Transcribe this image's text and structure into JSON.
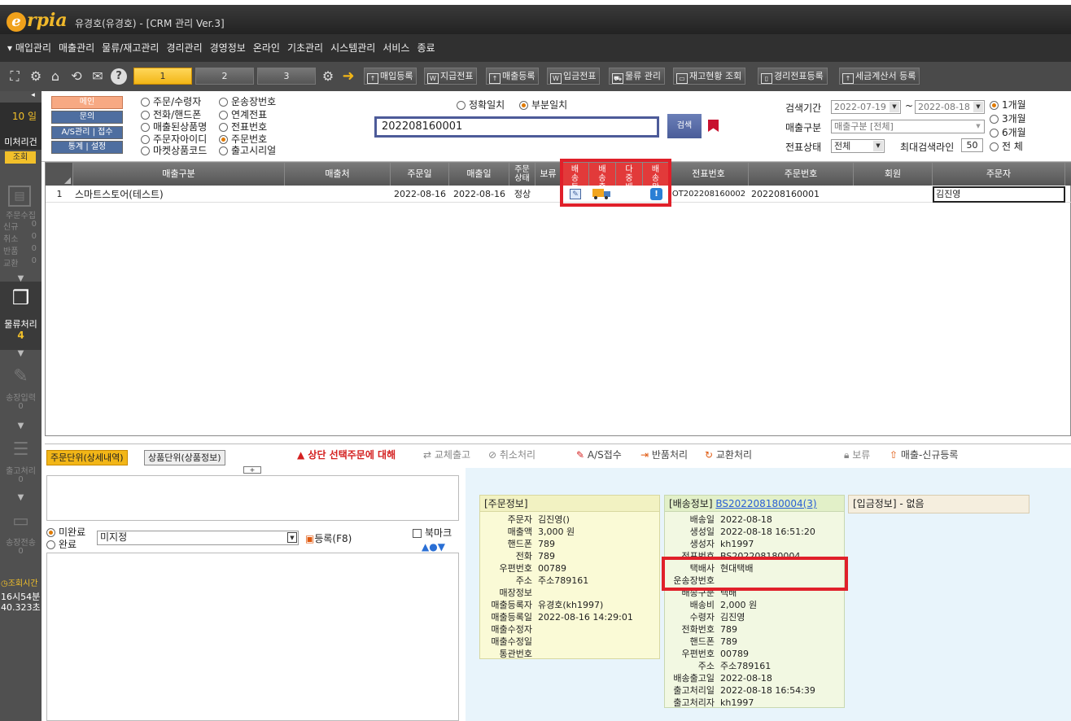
{
  "app": {
    "logo_letter": "e",
    "logo_text": "rpia",
    "title": "유경호(유경호) - [CRM 관리 Ver.3]"
  },
  "menu": [
    "▾ 매입관리",
    "매출관리",
    "물류/재고관리",
    "경리관리",
    "경영정보",
    "온라인",
    "기초관리",
    "시스템관리",
    "서비스",
    "종료"
  ],
  "toolbar": {
    "pages": [
      "1",
      "2",
      "3"
    ],
    "buttons": [
      "매입등록",
      "지급전표",
      "매출등록",
      "입금전표",
      "물류 관리",
      "재고현황 조회",
      "경리전표등록",
      "세금계산서 등록"
    ]
  },
  "sidebar": {
    "date": "10 일",
    "unprocessed": "미처리건",
    "lookup": "조회",
    "order": "주문수집",
    "new": "신규",
    "new_n": "0",
    "cancel": "취소",
    "cancel_n": "0",
    "ret": "반품",
    "ret_n": "0",
    "exch": "교환",
    "exch_n": "0",
    "logistics": "물류처리",
    "logistics_n": "4",
    "invoice": "송장입력",
    "invoice_n": "0",
    "release": "출고처리",
    "release_n": "0",
    "send": "송장전송",
    "send_n": "0",
    "time_label": "조회시간",
    "time1": "16시54분",
    "time2": "40.323초"
  },
  "filter": {
    "pills": [
      "메인",
      "문의",
      "A/S관리 | 접수",
      "통계 | 설정"
    ],
    "col1": [
      "주문/수령자",
      "전화/핸드폰",
      "매출된상품명",
      "주문자아이디",
      "마켓상품코드"
    ],
    "col2": [
      "운송장번호",
      "연계전표",
      "전표번호",
      "주문번호",
      "출고시리얼"
    ],
    "match_exact": "정확일치",
    "match_partial": "부분일치",
    "search_value": "202208160001",
    "search_btn": "검색",
    "period_label": "검색기간",
    "date_from": "2022-07-19",
    "date_to": "2022-08-18",
    "tilde": "~",
    "sales_label": "매출구분",
    "sales_value": "매출구분 [전체]",
    "status_label": "전표상태",
    "status_value": "전체",
    "max_label": "최대검색라인",
    "max_value": "50",
    "ranges": [
      "1개월",
      "3개월",
      "6개월",
      "전 체"
    ]
  },
  "grid": {
    "headers": [
      "매출구분",
      "매출처",
      "주문일",
      "매출일",
      "주문상태",
      "보류",
      "배송등록",
      "배송출고",
      "다중배송",
      "배송완료",
      "전표번호",
      "주문번호",
      "회원",
      "주문자"
    ],
    "row": {
      "no": "1",
      "sales_type": "스마트스토어(테스트)",
      "order_date": "2022-08-16",
      "sales_date": "2022-08-16",
      "status": "정상",
      "slip": "OT202208160002",
      "order_no": "202208160001",
      "buyer": "김진영"
    }
  },
  "bottom": {
    "tab1": "주문단위(상세내역)",
    "tab2": "상품단위(상품정보)",
    "notice": "▲ 상단 선택주문에 대해",
    "actions": [
      "교체출고",
      "취소처리",
      "A/S접수",
      "반품처리",
      "교환처리",
      "보류",
      "매출-신규등록"
    ],
    "incomplete": "미완료",
    "complete": "완료",
    "memo_select": "미지정",
    "register": "등록(F8)",
    "bookmark": "북마크",
    "plus": "+"
  },
  "order_info": {
    "title": "[주문정보]",
    "rows": [
      [
        "주문자",
        "김진영()"
      ],
      [
        "매출액",
        "3,000 원"
      ],
      [
        "핸드폰",
        "789"
      ],
      [
        "전화",
        "789"
      ],
      [
        "우편번호",
        "00789"
      ],
      [
        "주소",
        "주소789161"
      ],
      [
        "매장정보",
        ""
      ],
      [
        "매출등록자",
        "유경호(kh1997)"
      ],
      [
        "매출등록일",
        "2022-08-16 14:29:01"
      ],
      [
        "매출수정자",
        ""
      ],
      [
        "매출수정일",
        ""
      ],
      [
        "통관번호",
        ""
      ]
    ]
  },
  "ship_info": {
    "title": "[배송정보]",
    "link": "BS202208180004(3)",
    "rows": [
      [
        "배송일",
        "2022-08-18"
      ],
      [
        "생성일",
        "2022-08-18 16:51:20"
      ],
      [
        "생성자",
        "kh1997"
      ],
      [
        "전표번호",
        "BS202208180004"
      ],
      [
        "택배사",
        "현대택배"
      ],
      [
        "운송장번호",
        ""
      ],
      [
        "배송구분",
        "택배"
      ],
      [
        "배송비",
        "2,000 원"
      ],
      [
        "수령자",
        "김진영"
      ],
      [
        "전화번호",
        "789"
      ],
      [
        "핸드폰",
        "789"
      ],
      [
        "우편번호",
        "00789"
      ],
      [
        "주소",
        "주소789161"
      ],
      [
        "배송출고일",
        "2022-08-18"
      ],
      [
        "출고처리일",
        "2022-08-18 16:54:39"
      ],
      [
        "출고처리자",
        "kh1997"
      ]
    ]
  },
  "payment_info": {
    "title": "[입금정보] - 없음"
  }
}
